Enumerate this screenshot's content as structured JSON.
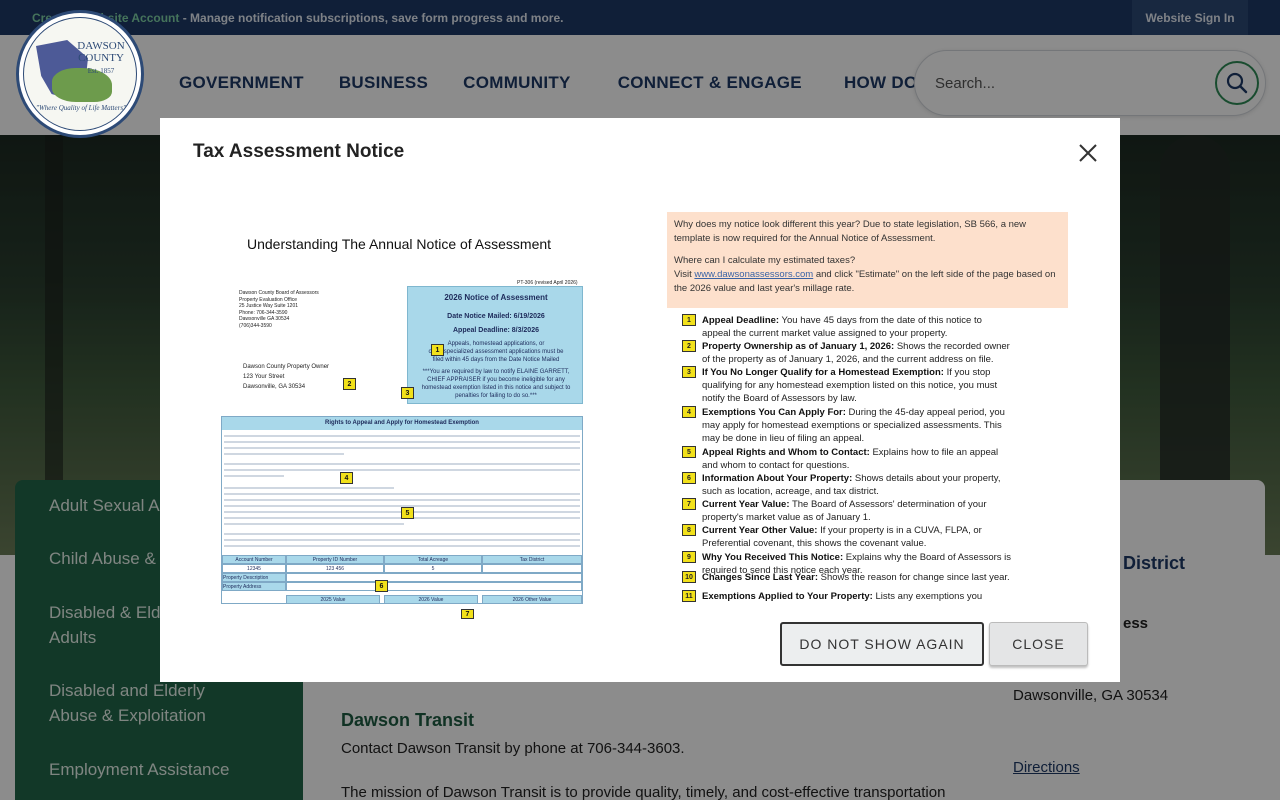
{
  "topbar": {
    "link_text": "Create a Website Account",
    "message": " - Manage notification subscriptions, save form progress and more.",
    "signin_label": "Website Sign In"
  },
  "logo": {
    "county": "DAWSON COUNTY",
    "est": "Est. 1857",
    "tagline": "\"Where Quality of Life Matters\""
  },
  "nav": [
    "GOVERNMENT",
    "BUSINESS",
    "COMMUNITY",
    "CONNECT & ENGAGE",
    "HOW DO I..."
  ],
  "search": {
    "placeholder": "Search...",
    "icon": "search-icon"
  },
  "sidebar": {
    "items": [
      "Adult Sexual As",
      "Child Abuse &",
      "Disabled & Elde\nAdults",
      "Disabled and Elderly\nAbuse & Exploitation",
      "Employment Assistance"
    ]
  },
  "content": {
    "heading": "Dawson Transit",
    "contact": "Contact Dawson Transit by phone at 706-344-3603.",
    "mission": "The mission of Dawson Transit is to provide quality, timely, and cost-effective transportation"
  },
  "right_column": {
    "district": "District",
    "address_label": "ess",
    "city": "Dawsonville, GA 30534",
    "directions": "Directions"
  },
  "modal": {
    "title": "Tax Assessment Notice",
    "close_icon": "close-icon",
    "doc_title": "Understanding The Annual Notice of Assessment",
    "form": {
      "pt": "PT-306 (revised April 2026)",
      "office_address": [
        "Dawson County Board of Assessors",
        "Property Evaluation Office",
        "25 Justice Way Suite 1201",
        "Phone: 706-344-3590",
        "Dawsonville GA 30534",
        "(706)344-3590"
      ],
      "notice_title": "2026 Notice of Assessment",
      "date_mailed": "Date Notice Mailed: 6/19/2026",
      "appeal_deadline": "Appeal Deadline: 8/3/2026",
      "notice_lines": [
        "Appeals, homestead applications, or",
        "other specialized assessment applications must be",
        "filed within 45 days from the Date Notice Mailed",
        "***You are required by law to notify ELAINE GARRETT,",
        "CHIEF APPRAISER if you become ineligible for any",
        "homestead exemption listed in this notice and subject to",
        "penalties for failing to do so.***"
      ],
      "owner": [
        "Dawson County Property Owner",
        "123 Your Street",
        "Dawsonville, GA 30534"
      ],
      "rights_header": "Rights to Appeal and Apply for Homestead Exemption",
      "table": {
        "headers": [
          "Account Number",
          "Property ID Number",
          "Total Acreage",
          "Tax District"
        ],
        "row": [
          "12345",
          "123 456",
          "5",
          ""
        ],
        "labels": [
          "Property Description",
          "Property Address"
        ],
        "value_headers": [
          "2025 Value",
          "2026 Value",
          "2026 Other Value"
        ]
      }
    },
    "intro": {
      "q1": "Why does my notice look different this year? Due to state legislation, SB 566, a new template is now required for the Annual Notice of Assessment.",
      "q2": "Where can I calculate my estimated taxes?",
      "visit": "Visit ",
      "link": "www.dawsonassessors.com",
      "visit_rest": " and click \"Estimate\" on the left side of the page based on the 2026 value and last year's millage rate."
    },
    "explanations": [
      {
        "num": "1",
        "title": "Appeal Deadline:",
        "text": " You have 45 days from the date of this notice to appeal the current market value assigned to your property."
      },
      {
        "num": "2",
        "title": "Property Ownership as of January 1, 2026:",
        "text": " Shows the recorded owner of the property as of January 1, 2026, and the current address on file."
      },
      {
        "num": "3",
        "title": "If You No Longer Qualify for a Homestead Exemption:",
        "text": " If you stop qualifying for any homestead exemption listed on this notice, you must notify the Board of Assessors by law."
      },
      {
        "num": "4",
        "title": "Exemptions You Can Apply For:",
        "text": " During the 45-day appeal period, you may apply for homestead exemptions or specialized assessments. This may be done in lieu of filing an appeal."
      },
      {
        "num": "5",
        "title": "Appeal Rights and Whom to Contact:",
        "text": " Explains how to file an appeal and whom to contact for questions."
      },
      {
        "num": "6",
        "title": "Information About Your Property:",
        "text": " Shows details about your property, such as location, acreage, and tax district."
      },
      {
        "num": "7",
        "title": "Current Year Value:",
        "text": " The Board of Assessors' determination of your property's market value as of January 1."
      },
      {
        "num": "8",
        "title": "Current Year Other Value:",
        "text": " If your property is in a CUVA, FLPA, or Preferential covenant, this shows the covenant value."
      },
      {
        "num": "9",
        "title": "Why You Received This Notice:",
        "text": " Explains why the Board of Assessors is required to send this notice each year."
      },
      {
        "num": "10",
        "title": "Changes Since Last Year:",
        "text": " Shows the reason for change since last year."
      },
      {
        "num": "11",
        "title": "Exemptions Applied to Your Property:",
        "text": " Lists any exemptions you"
      }
    ],
    "buttons": {
      "dont_show": "DO NOT SHOW AGAIN",
      "close": "CLOSE"
    }
  }
}
